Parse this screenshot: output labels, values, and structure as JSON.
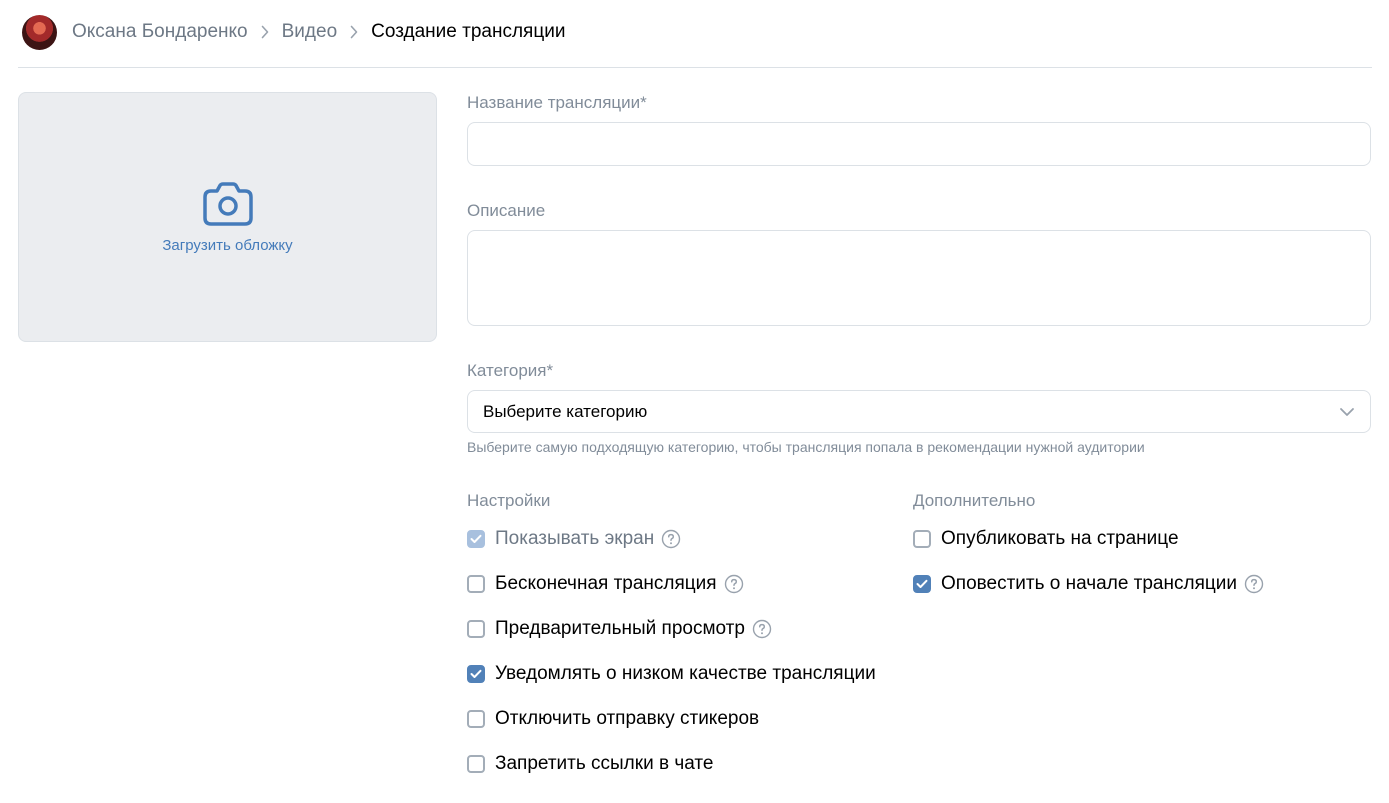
{
  "breadcrumb": {
    "user": "Оксана Бондаренко",
    "section": "Видео",
    "current": "Создание трансляции"
  },
  "cover": {
    "upload_label": "Загрузить обложку",
    "icon": "camera-icon"
  },
  "form": {
    "title_label": "Название трансляции*",
    "title_value": "",
    "description_label": "Описание",
    "description_value": "",
    "category_label": "Категория*",
    "category_value": "Выберите категорию",
    "category_hint": "Выберите самую подходящую категорию, чтобы трансляция попала в рекомендации нужной аудитории"
  },
  "settings": {
    "title": "Настройки",
    "items": [
      {
        "label": "Показывать экран",
        "checked": true,
        "disabled": true,
        "help": true
      },
      {
        "label": "Бесконечная трансляция",
        "checked": false,
        "help": true
      },
      {
        "label": "Предварительный просмотр",
        "checked": false,
        "help": true
      },
      {
        "label": "Уведомлять о низком качестве трансляции",
        "checked": true,
        "help": false
      },
      {
        "label": "Отключить отправку стикеров",
        "checked": false,
        "help": false
      },
      {
        "label": "Запретить ссылки в чате",
        "checked": false,
        "help": false
      }
    ]
  },
  "extra": {
    "title": "Дополнительно",
    "items": [
      {
        "label": "Опубликовать на странице",
        "checked": false,
        "help": false
      },
      {
        "label": "Оповестить о начале трансляции",
        "checked": true,
        "help": true
      }
    ]
  },
  "colors": {
    "accent": "#5181b8",
    "link": "#447bba",
    "secondary": "#818c99",
    "border": "#dce1e6"
  }
}
